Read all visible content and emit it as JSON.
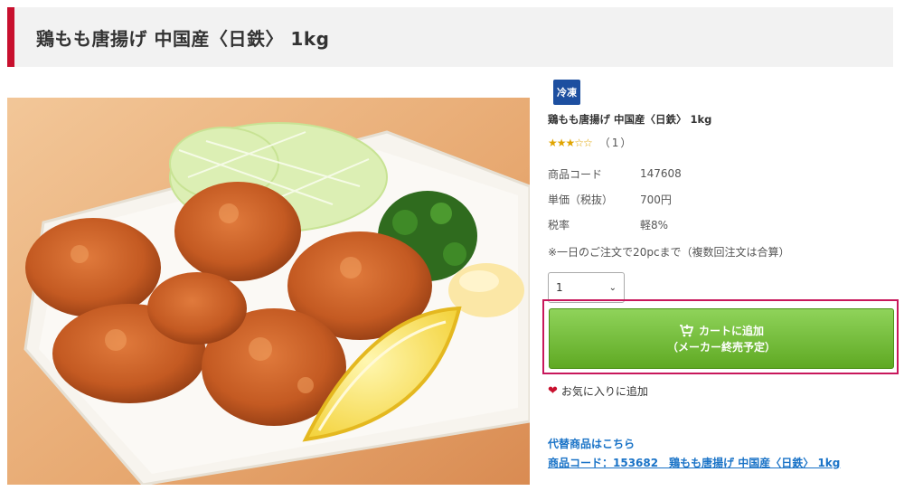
{
  "page_title": "鶏もも唐揚げ 中国産〈日鉄〉 1kg",
  "accent_color": "#c8102e",
  "badge": "冷凍",
  "product_name": "鶏もも唐揚げ 中国産〈日鉄〉 1kg",
  "rating": {
    "stars": 3,
    "max": 5,
    "count_label": "（1）"
  },
  "specs": [
    {
      "label": "商品コード",
      "value": "147608"
    },
    {
      "label": "単価（税抜）",
      "value": "700円"
    },
    {
      "label": "税率",
      "value": "軽8%"
    }
  ],
  "note": "※一日のご注文で20pcまで（複数回注文は合算）",
  "quantity": {
    "selected": "1"
  },
  "cart_button": {
    "line1": "カートに追加",
    "line2": "（メーカー終売予定）"
  },
  "favorite_label": "お気に入りに追加",
  "alternative": {
    "heading": "代替商品はこちら",
    "link": "商品コード：153682　鶏もも唐揚げ 中国産〈日鉄〉 1kg"
  }
}
